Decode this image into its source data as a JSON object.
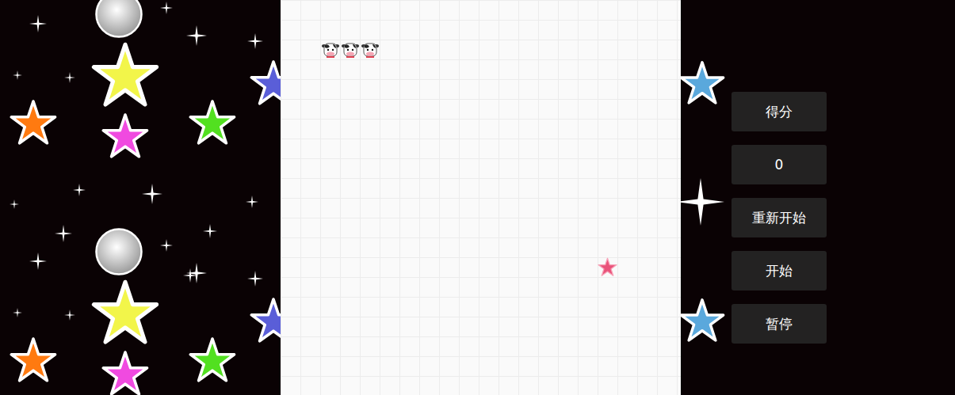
{
  "score": {
    "label": "得分",
    "value": "0"
  },
  "buttons": [
    {
      "label": "重新开始"
    },
    {
      "label": "开始"
    },
    {
      "label": "暂停"
    }
  ],
  "board": {
    "cols": 20,
    "rows": 20
  },
  "snake": [
    {
      "col": 2,
      "row": 2
    },
    {
      "col": 3,
      "row": 2
    },
    {
      "col": 4,
      "row": 2
    }
  ],
  "food": {
    "col": 16,
    "row": 13
  }
}
